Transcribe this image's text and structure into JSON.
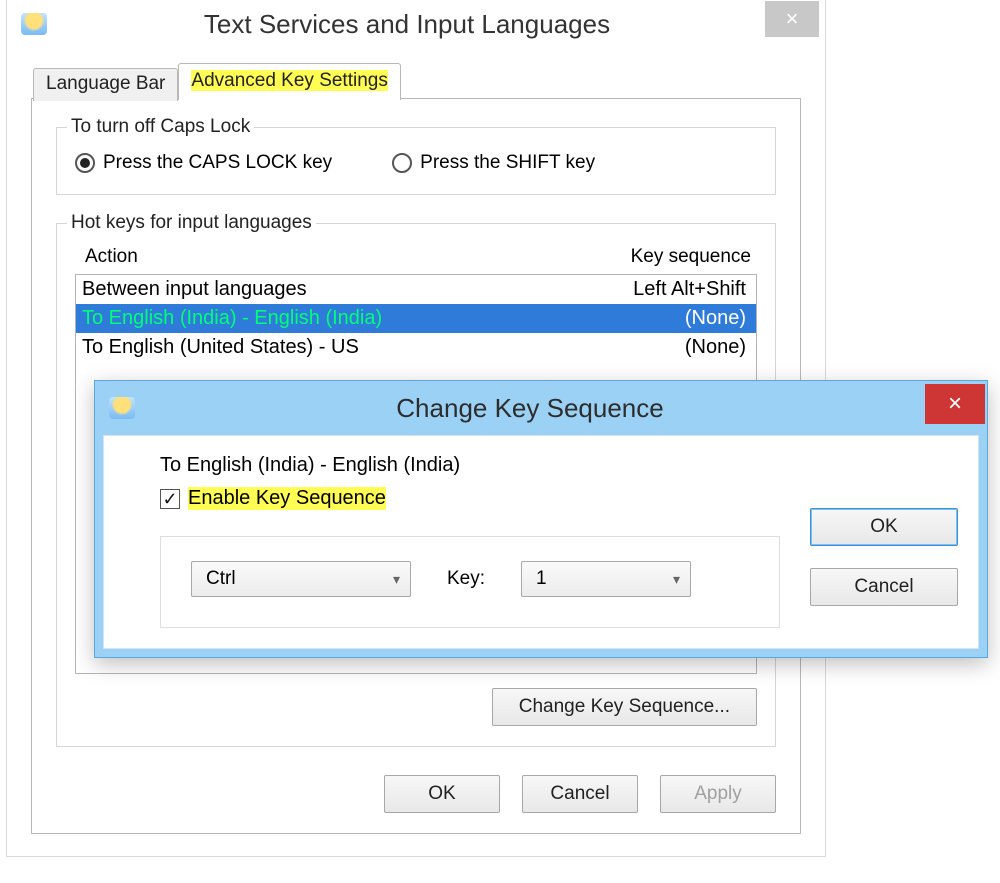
{
  "main": {
    "title": "Text Services and Input Languages",
    "tabs": {
      "inactive": "Language Bar",
      "active": "Advanced Key Settings"
    },
    "caps": {
      "legend": "To turn off Caps Lock",
      "opt1": "Press the CAPS LOCK key",
      "opt2": "Press the SHIFT key"
    },
    "hotkeys": {
      "legend": "Hot keys for input languages",
      "head_action": "Action",
      "head_seq": "Key sequence",
      "rows": [
        {
          "action": "Between input languages",
          "seq": "Left Alt+Shift"
        },
        {
          "action": "To English (India) - English (India)",
          "seq": "(None)"
        },
        {
          "action": "To English (United States) - US",
          "seq": "(None)"
        }
      ],
      "change_btn": "Change Key Sequence..."
    },
    "buttons": {
      "ok": "OK",
      "cancel": "Cancel",
      "apply": "Apply"
    }
  },
  "child": {
    "title": "Change Key Sequence",
    "caption": "To English (India) - English (India)",
    "enable_label": "Enable Key Sequence",
    "modifier": "Ctrl",
    "key_label": "Key:",
    "key_value": "1",
    "ok": "OK",
    "cancel": "Cancel"
  }
}
